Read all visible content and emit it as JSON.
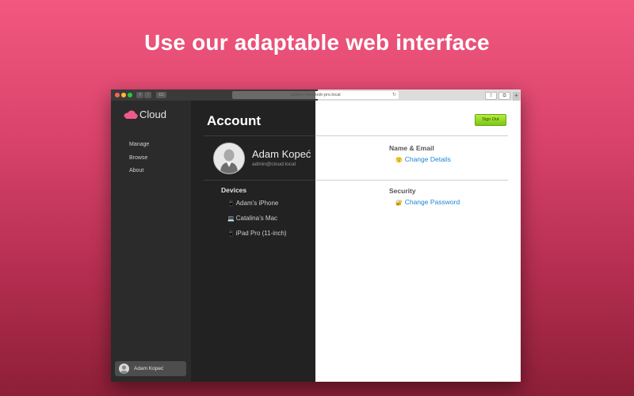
{
  "headline": "Use our adaptable web interface",
  "browser": {
    "url": "adams-macbook-pro.local"
  },
  "app": {
    "logo_text": "Cloud",
    "nav": [
      "Manage",
      "Browse",
      "About"
    ],
    "current_user_chip": "Adam Kopeć"
  },
  "account": {
    "title": "Account",
    "sign_out": "Sign Out",
    "user_name": "Adam Kopeć",
    "user_email": "admin@cloud.local",
    "name_email_heading": "Name & Email",
    "change_details_icon": "😗",
    "change_details": "Change Details",
    "security_heading": "Security",
    "change_password_icon": "🔐",
    "change_password": "Change Password",
    "devices_heading": "Devices",
    "devices": [
      {
        "icon": "📱",
        "name": "Adam’s iPhone"
      },
      {
        "icon": "💻",
        "name": "Catalina’s Mac"
      },
      {
        "icon": "📱",
        "name": "iPad Pro (11-inch)"
      }
    ]
  },
  "colors": {
    "accent_link": "#1a86d6",
    "signout_green": "#8fd41f",
    "background_top": "#f2587f",
    "background_bottom": "#8d1f37"
  }
}
